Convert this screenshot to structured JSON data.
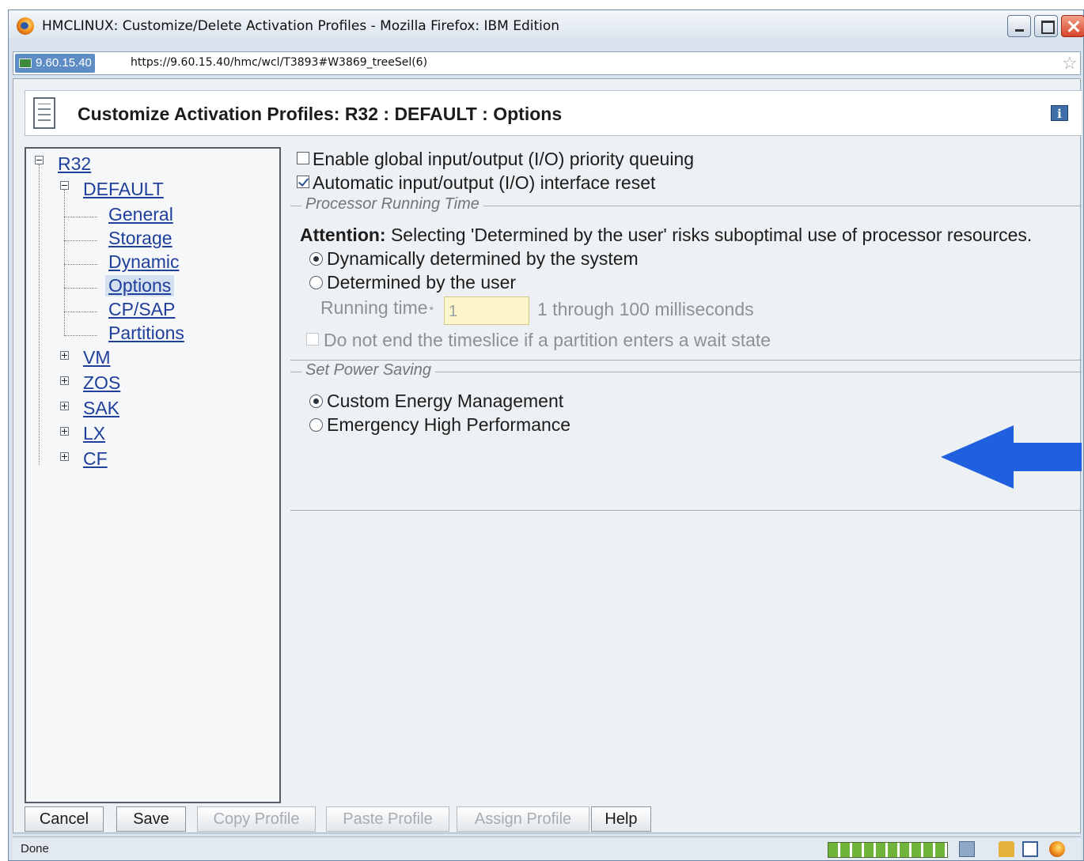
{
  "window": {
    "title": "HMCLINUX: Customize/Delete Activation Profiles - Mozilla Firefox: IBM Edition"
  },
  "address_bar": {
    "site": "9.60.15.40",
    "url": "https://9.60.15.40/hmc/wcl/T3893#W3869_treeSel(6)"
  },
  "header": {
    "title": "Customize Activation Profiles: R32 : DEFAULT : Options",
    "info_label": "i"
  },
  "tree": {
    "root": "R32",
    "profile": "DEFAULT",
    "pages": [
      "General",
      "Storage",
      "Dynamic",
      "Options",
      "CP/SAP",
      "Partitions"
    ],
    "selected_page": "Options",
    "other_images": [
      "VM",
      "ZOS",
      "SAK",
      "LX",
      "CF"
    ]
  },
  "options": {
    "global_io_priority": {
      "label": "Enable global input/output (I/O) priority queuing",
      "checked": false
    },
    "io_interface_reset": {
      "label": "Automatic input/output (I/O) interface reset",
      "checked": true
    },
    "processor_running_time": {
      "legend": "Processor Running Time",
      "attention_bold": "Attention:",
      "attention_text": " Selecting 'Determined by the user' risks suboptimal use of processor resources.",
      "radio_dynamic": {
        "label": "Dynamically determined by the system",
        "selected": true
      },
      "radio_user": {
        "label": "Determined by the user",
        "selected": false
      },
      "running_time_label": "Running time",
      "running_time_required_marker": "*",
      "running_time_value": "1",
      "running_time_hint": "1 through 100 milliseconds",
      "timeslice_wait": {
        "label": "Do not end the timeslice if a partition enters a wait state",
        "checked": false,
        "enabled": false
      }
    },
    "power_saving": {
      "legend": "Set Power Saving",
      "radio_custom": {
        "label": "Custom Energy Management",
        "selected": true
      },
      "radio_emergency": {
        "label": "Emergency High Performance",
        "selected": false
      }
    }
  },
  "buttons": {
    "cancel": "Cancel",
    "save": "Save",
    "copy_profile": "Copy Profile",
    "paste_profile": "Paste Profile",
    "assign_profile": "Assign Profile",
    "help": "Help"
  },
  "status": {
    "text": "Done"
  },
  "colors": {
    "arrow": "#2060e0",
    "link": "#1f3f9c",
    "input_bg": "#fcf5c9"
  }
}
